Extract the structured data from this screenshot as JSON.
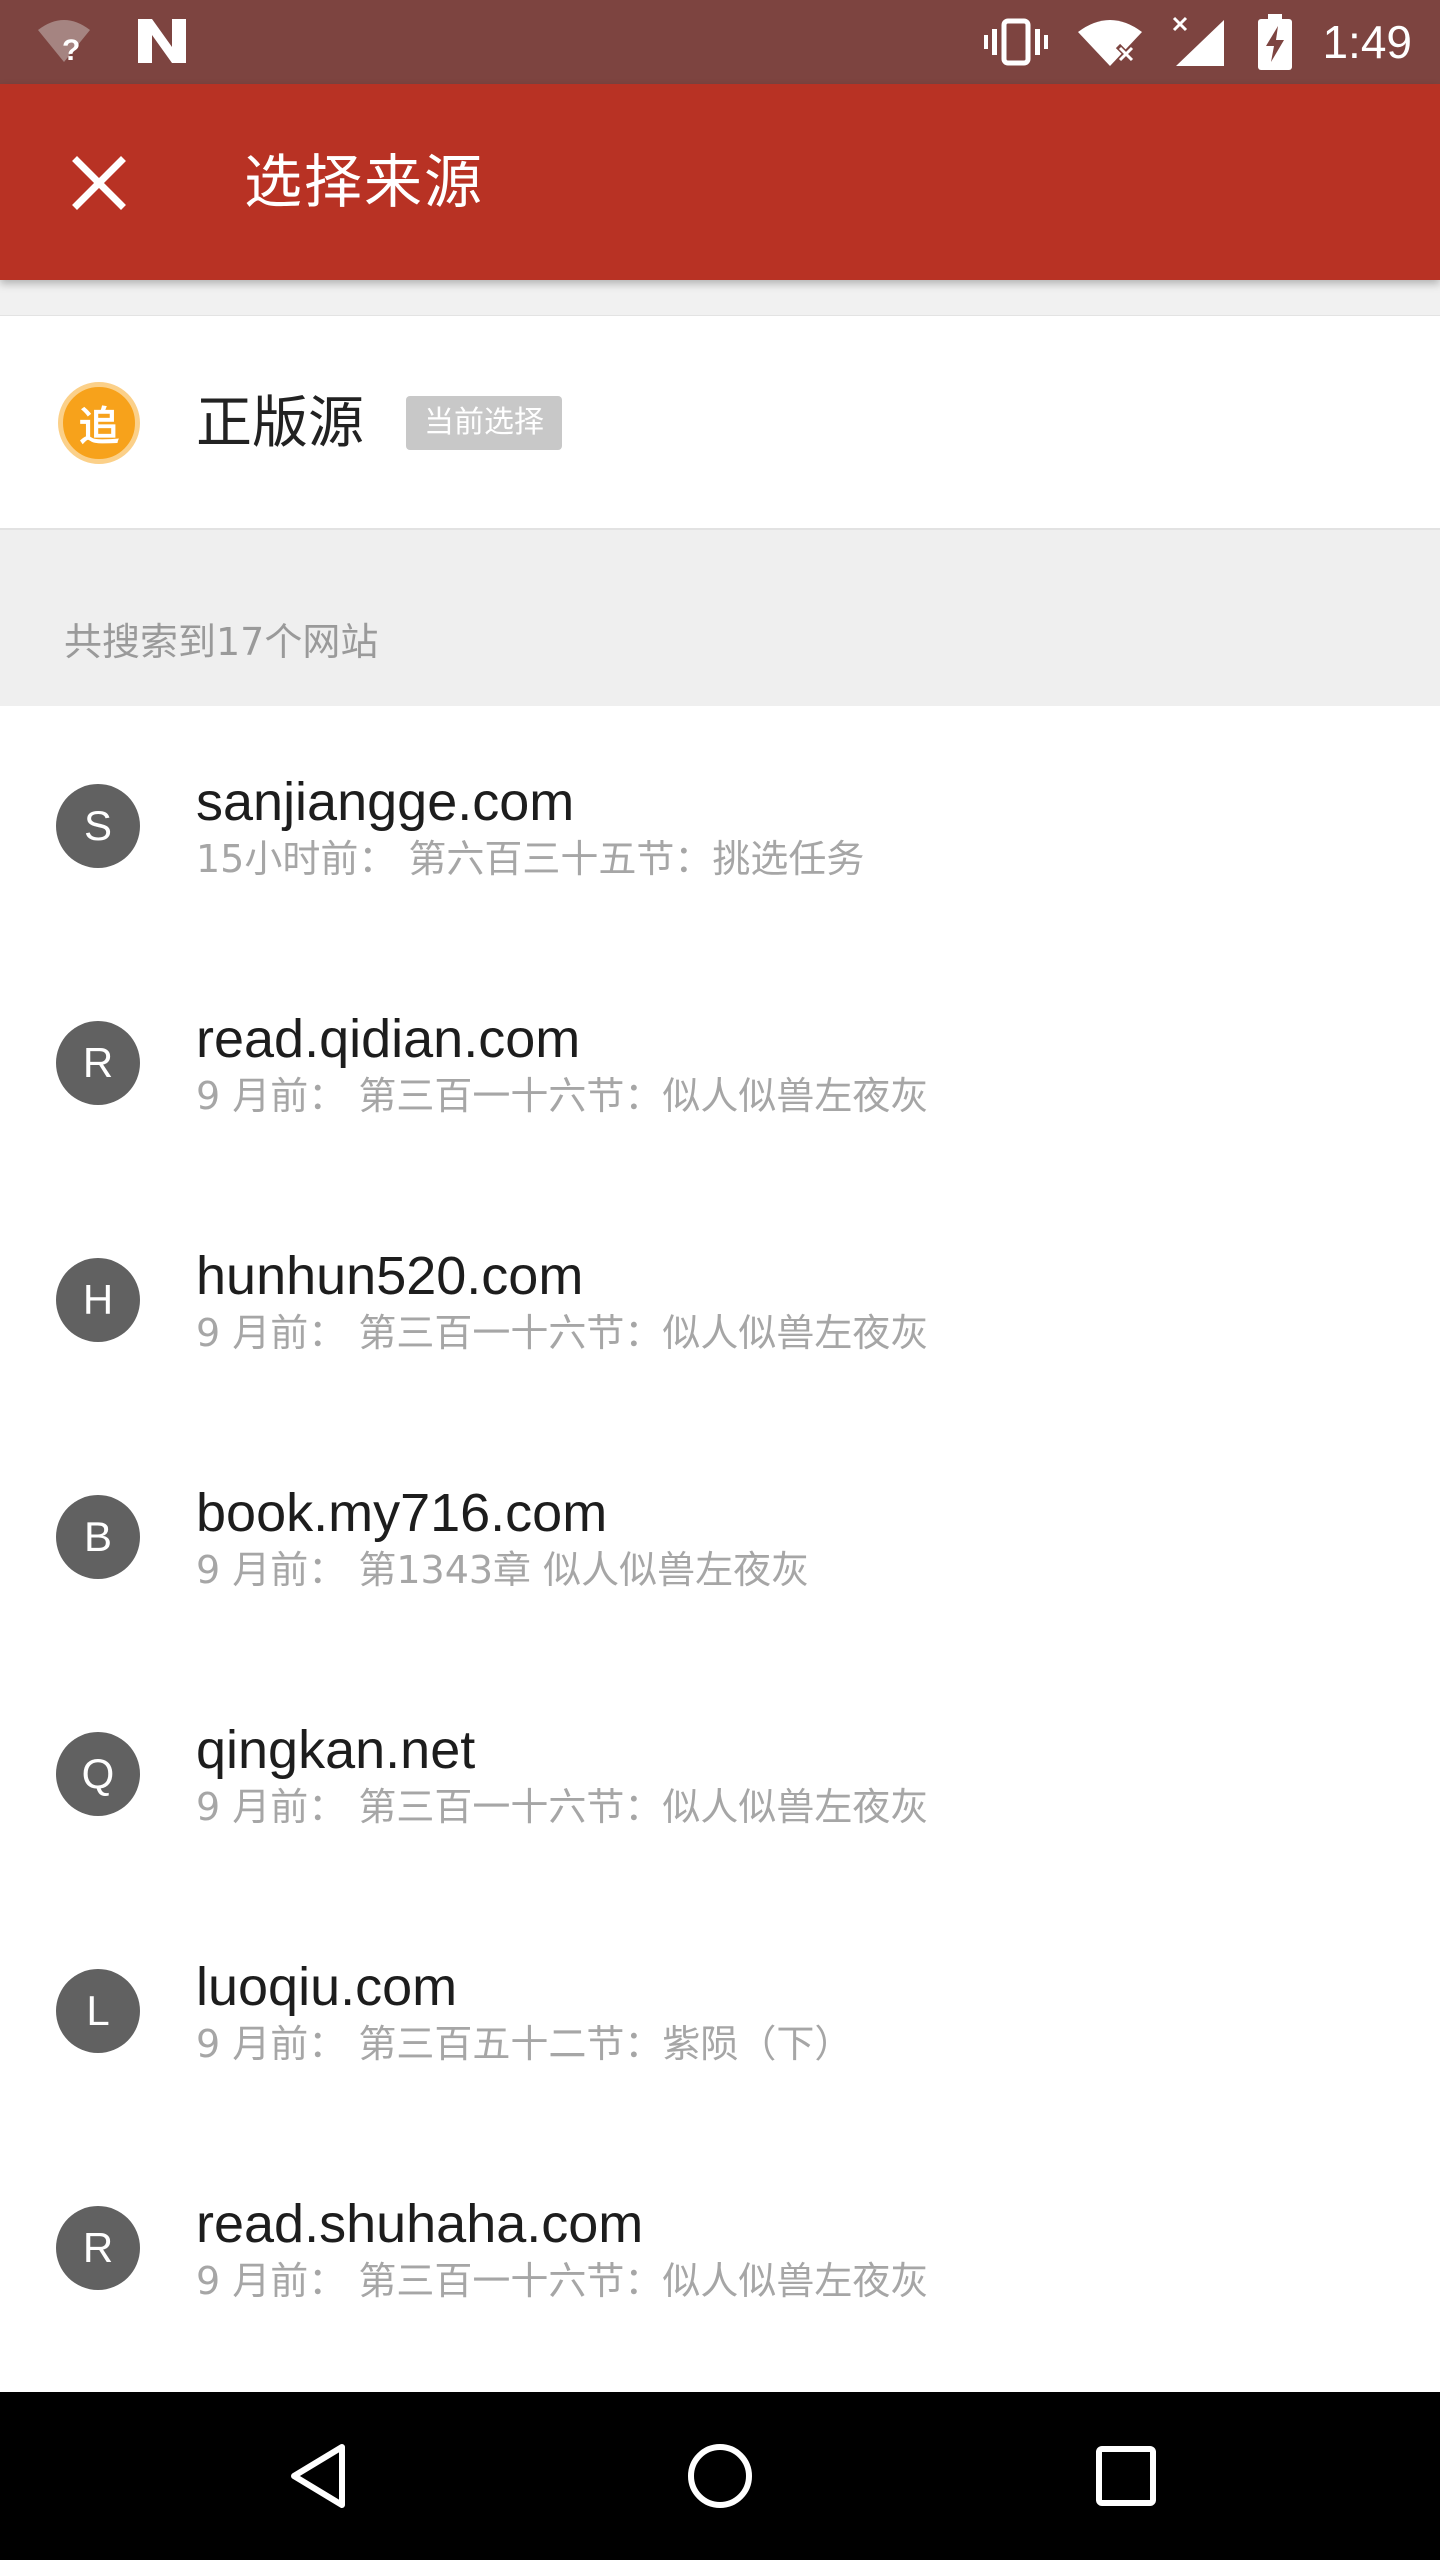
{
  "status_bar": {
    "time": "1:49",
    "icons": [
      "wifi-question-icon",
      "n-notification-icon",
      "vibrate-icon",
      "wifi-x-icon",
      "signal-icon",
      "battery-charging-icon"
    ]
  },
  "app_bar": {
    "title": "选择来源",
    "close_icon": "close-icon"
  },
  "official": {
    "logo_char": "追",
    "name": "正版源",
    "badge": "当前选择"
  },
  "summary": "共搜索到17个网站",
  "sources": [
    {
      "initial": "S",
      "site": "sanjiangge.com",
      "meta": "15小时前：  第六百三十五节：挑选任务"
    },
    {
      "initial": "R",
      "site": "read.qidian.com",
      "meta": "9 月前：  第三百一十六节：似人似兽左夜灰"
    },
    {
      "initial": "H",
      "site": "hunhun520.com",
      "meta": "9 月前：  第三百一十六节：似人似兽左夜灰"
    },
    {
      "initial": "B",
      "site": "book.my716.com",
      "meta": "9 月前：  第1343章 似人似兽左夜灰"
    },
    {
      "initial": "Q",
      "site": "qingkan.net",
      "meta": "9 月前：  第三百一十六节：似人似兽左夜灰"
    },
    {
      "initial": "L",
      "site": "luoqiu.com",
      "meta": "9 月前：  第三百五十二节：紫陨（下）"
    },
    {
      "initial": "R",
      "site": "read.shuhaha.com",
      "meta": "9 月前：  第三百一十六节：似人似兽左夜灰"
    }
  ],
  "nav_bar": {
    "icons": [
      "back-icon",
      "home-icon",
      "recents-icon"
    ]
  },
  "colors": {
    "status_bar": "#7d4440",
    "app_bar": "#b83224",
    "avatar": "#616161",
    "logo": "#f7a21b"
  }
}
